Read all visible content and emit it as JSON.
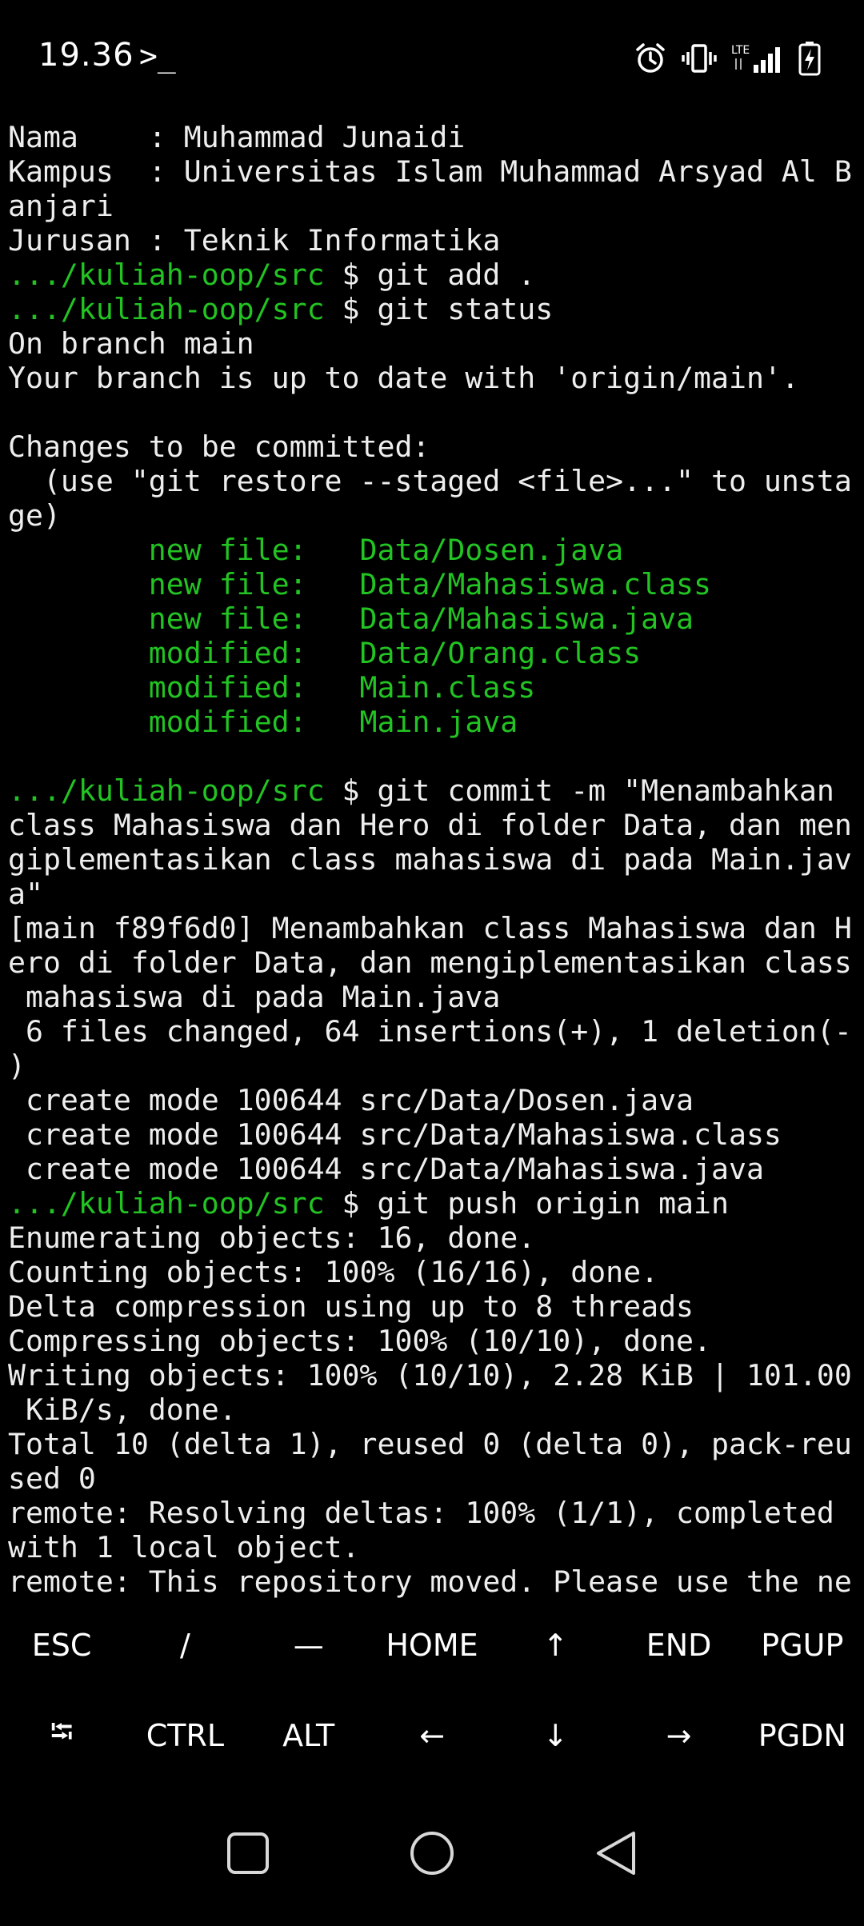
{
  "status_bar": {
    "time": "19.36",
    "prompt_icon": ">_",
    "icons": [
      "alarm-icon",
      "vibrate-icon",
      "lte-signal-icon",
      "battery-charging-icon"
    ],
    "lte_label": "LTE"
  },
  "terminal": {
    "lines": [
      {
        "parts": [
          {
            "t": "Nama    : Muhammad Junaidi",
            "c": "white"
          }
        ]
      },
      {
        "parts": [
          {
            "t": "Kampus  : Universitas Islam Muhammad Arsyad Al B",
            "c": "white"
          }
        ]
      },
      {
        "parts": [
          {
            "t": "anjari",
            "c": "white"
          }
        ]
      },
      {
        "parts": [
          {
            "t": "Jurusan : Teknik Informatika",
            "c": "white"
          }
        ]
      },
      {
        "parts": [
          {
            "t": ".../kuliah-oop/src",
            "c": "green"
          },
          {
            "t": " $ git add .",
            "c": "white"
          }
        ]
      },
      {
        "parts": [
          {
            "t": ".../kuliah-oop/src",
            "c": "green"
          },
          {
            "t": " $ git status",
            "c": "white"
          }
        ]
      },
      {
        "parts": [
          {
            "t": "On branch main",
            "c": "white"
          }
        ]
      },
      {
        "parts": [
          {
            "t": "Your branch is up to date with 'origin/main'.",
            "c": "white"
          }
        ]
      },
      {
        "parts": [
          {
            "t": "",
            "c": "white"
          }
        ]
      },
      {
        "parts": [
          {
            "t": "Changes to be committed:",
            "c": "white"
          }
        ]
      },
      {
        "parts": [
          {
            "t": "  (use \"git restore --staged <file>...\" to unsta",
            "c": "white"
          }
        ]
      },
      {
        "parts": [
          {
            "t": "ge)",
            "c": "white"
          }
        ]
      },
      {
        "parts": [
          {
            "t": "        new file:   Data/Dosen.java",
            "c": "green"
          }
        ]
      },
      {
        "parts": [
          {
            "t": "        new file:   Data/Mahasiswa.class",
            "c": "green"
          }
        ]
      },
      {
        "parts": [
          {
            "t": "        new file:   Data/Mahasiswa.java",
            "c": "green"
          }
        ]
      },
      {
        "parts": [
          {
            "t": "        modified:   Data/Orang.class",
            "c": "green"
          }
        ]
      },
      {
        "parts": [
          {
            "t": "        modified:   Main.class",
            "c": "green"
          }
        ]
      },
      {
        "parts": [
          {
            "t": "        modified:   Main.java",
            "c": "green"
          }
        ]
      },
      {
        "parts": [
          {
            "t": "",
            "c": "white"
          }
        ]
      },
      {
        "parts": [
          {
            "t": ".../kuliah-oop/src",
            "c": "green"
          },
          {
            "t": " $ git commit -m \"Menambahkan",
            "c": "white"
          }
        ]
      },
      {
        "parts": [
          {
            "t": "class Mahasiswa dan Hero di folder Data, dan men",
            "c": "white"
          }
        ]
      },
      {
        "parts": [
          {
            "t": "giplementasikan class mahasiswa di pada Main.jav",
            "c": "white"
          }
        ]
      },
      {
        "parts": [
          {
            "t": "a\"",
            "c": "white"
          }
        ]
      },
      {
        "parts": [
          {
            "t": "[main f89f6d0] Menambahkan class Mahasiswa dan H",
            "c": "white"
          }
        ]
      },
      {
        "parts": [
          {
            "t": "ero di folder Data, dan mengiplementasikan class",
            "c": "white"
          }
        ]
      },
      {
        "parts": [
          {
            "t": " mahasiswa di pada Main.java",
            "c": "white"
          }
        ]
      },
      {
        "parts": [
          {
            "t": " 6 files changed, 64 insertions(+), 1 deletion(-",
            "c": "white"
          }
        ]
      },
      {
        "parts": [
          {
            "t": ")",
            "c": "white"
          }
        ]
      },
      {
        "parts": [
          {
            "t": " create mode 100644 src/Data/Dosen.java",
            "c": "white"
          }
        ]
      },
      {
        "parts": [
          {
            "t": " create mode 100644 src/Data/Mahasiswa.class",
            "c": "white"
          }
        ]
      },
      {
        "parts": [
          {
            "t": " create mode 100644 src/Data/Mahasiswa.java",
            "c": "white"
          }
        ]
      },
      {
        "parts": [
          {
            "t": ".../kuliah-oop/src",
            "c": "green"
          },
          {
            "t": " $ git push origin main",
            "c": "white"
          }
        ]
      },
      {
        "parts": [
          {
            "t": "Enumerating objects: 16, done.",
            "c": "white"
          }
        ]
      },
      {
        "parts": [
          {
            "t": "Counting objects: 100% (16/16), done.",
            "c": "white"
          }
        ]
      },
      {
        "parts": [
          {
            "t": "Delta compression using up to 8 threads",
            "c": "white"
          }
        ]
      },
      {
        "parts": [
          {
            "t": "Compressing objects: 100% (10/10), done.",
            "c": "white"
          }
        ]
      },
      {
        "parts": [
          {
            "t": "Writing objects: 100% (10/10), 2.28 KiB | 101.00",
            "c": "white"
          }
        ]
      },
      {
        "parts": [
          {
            "t": " KiB/s, done.",
            "c": "white"
          }
        ]
      },
      {
        "parts": [
          {
            "t": "Total 10 (delta 1), reused 0 (delta 0), pack-reu",
            "c": "white"
          }
        ]
      },
      {
        "parts": [
          {
            "t": "sed 0",
            "c": "white"
          }
        ]
      },
      {
        "parts": [
          {
            "t": "remote: Resolving deltas: 100% (1/1), completed",
            "c": "white"
          }
        ]
      },
      {
        "parts": [
          {
            "t": "with 1 local object.",
            "c": "white"
          }
        ]
      },
      {
        "parts": [
          {
            "t": "remote: This repository moved. Please use the ne",
            "c": "white"
          }
        ]
      }
    ]
  },
  "extra_keys": {
    "row1": [
      {
        "label": "ESC",
        "name": "key-esc"
      },
      {
        "label": "/",
        "name": "key-slash"
      },
      {
        "label": "—",
        "name": "key-dash"
      },
      {
        "label": "HOME",
        "name": "key-home"
      },
      {
        "label": "↑",
        "name": "key-up"
      },
      {
        "label": "END",
        "name": "key-end"
      },
      {
        "label": "PGUP",
        "name": "key-pgup"
      }
    ],
    "row2": [
      {
        "label": "⭾",
        "name": "key-tab"
      },
      {
        "label": "CTRL",
        "name": "key-ctrl"
      },
      {
        "label": "ALT",
        "name": "key-alt"
      },
      {
        "label": "←",
        "name": "key-left"
      },
      {
        "label": "↓",
        "name": "key-down"
      },
      {
        "label": "→",
        "name": "key-right"
      },
      {
        "label": "PGDN",
        "name": "key-pgdn"
      }
    ]
  },
  "nav_bar": {
    "buttons": [
      "recents-icon",
      "home-icon",
      "back-icon"
    ]
  },
  "colors": {
    "background": "#000000",
    "text": "#eeeeee",
    "prompt_green": "#22c322"
  }
}
